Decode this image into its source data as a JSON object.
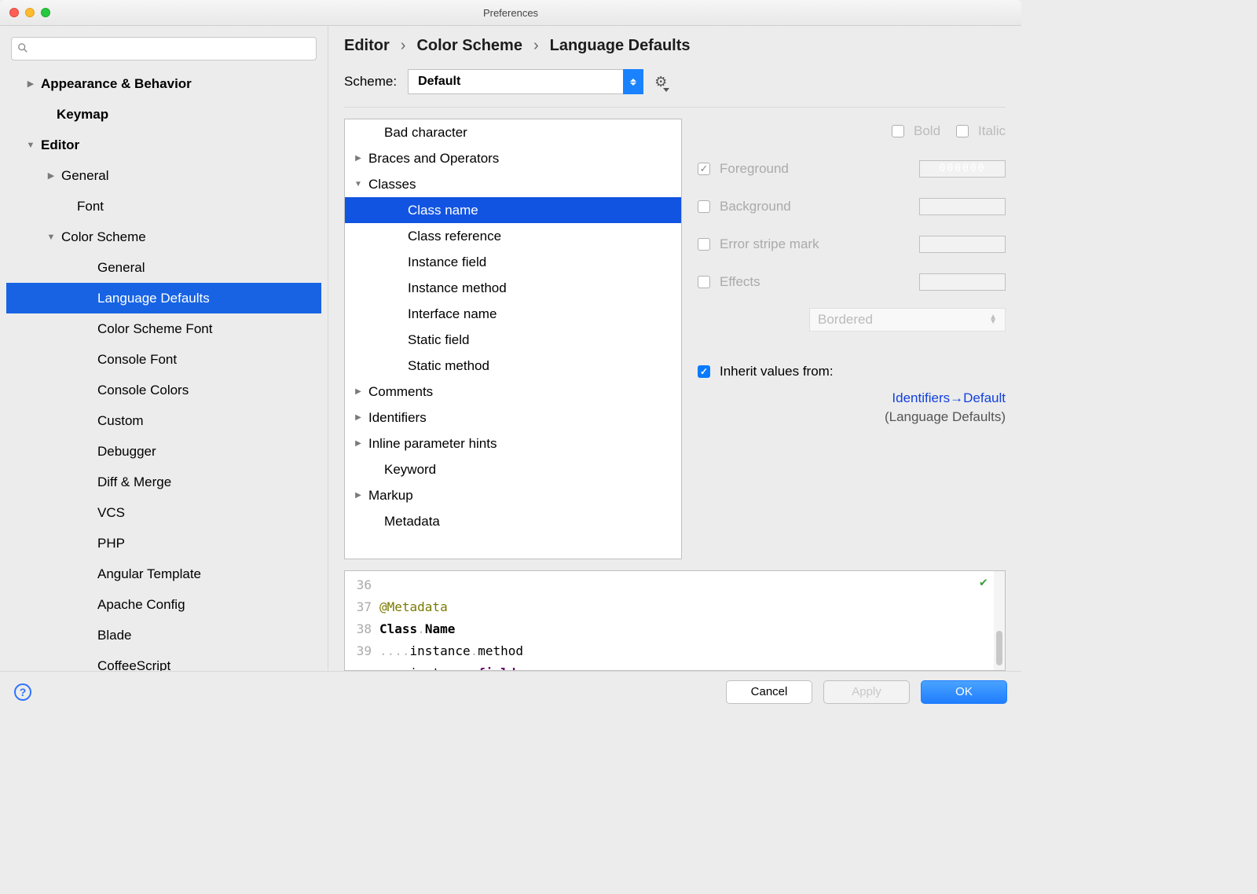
{
  "window": {
    "title": "Preferences"
  },
  "search": {
    "placeholder": ""
  },
  "sidebar": [
    {
      "label": "Appearance & Behavior",
      "indent": 24,
      "arrow": "▶",
      "bold": true
    },
    {
      "label": "Keymap",
      "indent": 44,
      "arrow": "",
      "bold": true
    },
    {
      "label": "Editor",
      "indent": 24,
      "arrow": "▼",
      "bold": true
    },
    {
      "label": "General",
      "indent": 50,
      "arrow": "▶",
      "bold": false
    },
    {
      "label": "Font",
      "indent": 70,
      "arrow": "",
      "bold": false
    },
    {
      "label": "Color Scheme",
      "indent": 50,
      "arrow": "▼",
      "bold": false
    },
    {
      "label": "General",
      "indent": 96,
      "arrow": "",
      "bold": false
    },
    {
      "label": "Language Defaults",
      "indent": 96,
      "arrow": "",
      "bold": false,
      "selected": true
    },
    {
      "label": "Color Scheme Font",
      "indent": 96,
      "arrow": "",
      "bold": false
    },
    {
      "label": "Console Font",
      "indent": 96,
      "arrow": "",
      "bold": false
    },
    {
      "label": "Console Colors",
      "indent": 96,
      "arrow": "",
      "bold": false
    },
    {
      "label": "Custom",
      "indent": 96,
      "arrow": "",
      "bold": false
    },
    {
      "label": "Debugger",
      "indent": 96,
      "arrow": "",
      "bold": false
    },
    {
      "label": "Diff & Merge",
      "indent": 96,
      "arrow": "",
      "bold": false
    },
    {
      "label": "VCS",
      "indent": 96,
      "arrow": "",
      "bold": false
    },
    {
      "label": "PHP",
      "indent": 96,
      "arrow": "",
      "bold": false
    },
    {
      "label": "Angular Template",
      "indent": 96,
      "arrow": "",
      "bold": false
    },
    {
      "label": "Apache Config",
      "indent": 96,
      "arrow": "",
      "bold": false
    },
    {
      "label": "Blade",
      "indent": 96,
      "arrow": "",
      "bold": false
    },
    {
      "label": "CoffeeScript",
      "indent": 96,
      "arrow": "",
      "bold": false
    }
  ],
  "breadcrumb": [
    "Editor",
    "Color Scheme",
    "Language Defaults"
  ],
  "scheme": {
    "label": "Scheme:",
    "value": "Default"
  },
  "tree": [
    {
      "label": "Bad character",
      "indent": 30,
      "arrow": ""
    },
    {
      "label": "Braces and Operators",
      "indent": 10,
      "arrow": "▶"
    },
    {
      "label": "Classes",
      "indent": 10,
      "arrow": "▼"
    },
    {
      "label": "Class name",
      "indent": 60,
      "arrow": "",
      "selected": true
    },
    {
      "label": "Class reference",
      "indent": 60,
      "arrow": ""
    },
    {
      "label": "Instance field",
      "indent": 60,
      "arrow": ""
    },
    {
      "label": "Instance method",
      "indent": 60,
      "arrow": ""
    },
    {
      "label": "Interface name",
      "indent": 60,
      "arrow": ""
    },
    {
      "label": "Static field",
      "indent": 60,
      "arrow": ""
    },
    {
      "label": "Static method",
      "indent": 60,
      "arrow": ""
    },
    {
      "label": "Comments",
      "indent": 10,
      "arrow": "▶"
    },
    {
      "label": "Identifiers",
      "indent": 10,
      "arrow": "▶"
    },
    {
      "label": "Inline parameter hints",
      "indent": 10,
      "arrow": "▶"
    },
    {
      "label": "Keyword",
      "indent": 30,
      "arrow": ""
    },
    {
      "label": "Markup",
      "indent": 10,
      "arrow": "▶"
    },
    {
      "label": "Metadata",
      "indent": 30,
      "arrow": ""
    }
  ],
  "props": {
    "bold": "Bold",
    "italic": "Italic",
    "foreground": "Foreground",
    "foreground_value": "000000",
    "background": "Background",
    "errorstripe": "Error stripe mark",
    "effects": "Effects",
    "effects_type": "Bordered",
    "inherit": "Inherit values from:",
    "inherit_link": "Identifiers→Default",
    "inherit_sub": "(Language Defaults)"
  },
  "preview": {
    "lines": [
      36,
      37,
      38,
      39
    ],
    "l36": "@Metadata",
    "l37a": "Class",
    "l37b": "Name",
    "l38a": "instance",
    "l38b": "method",
    "l39a": "instance",
    "l39b": "field"
  },
  "footer": {
    "cancel": "Cancel",
    "apply": "Apply",
    "ok": "OK"
  }
}
